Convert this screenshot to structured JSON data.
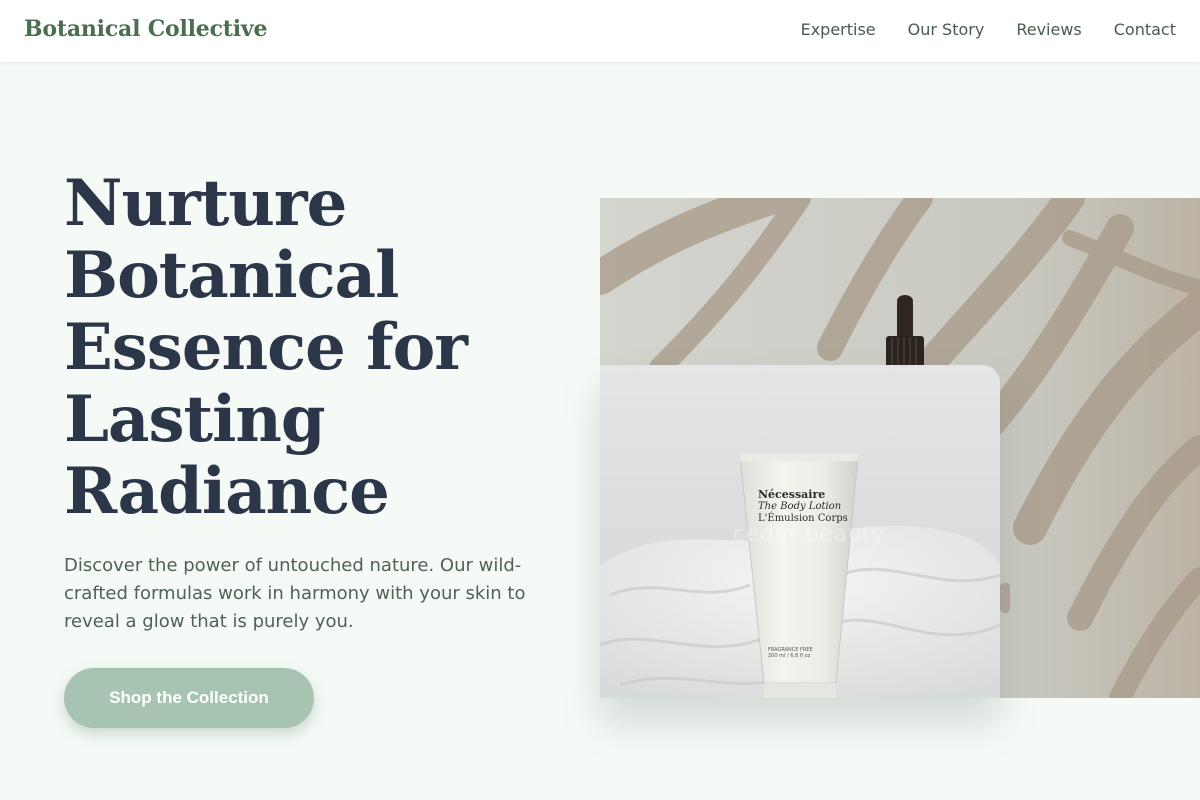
{
  "header": {
    "brand": "Botanical Collective",
    "nav": [
      "Expertise",
      "Our Story",
      "Reviews",
      "Contact"
    ]
  },
  "hero": {
    "title_lines": [
      "Nurture",
      "Botanical",
      "Essence for",
      "Lasting",
      "Radiance"
    ],
    "description": "Discover the power of untouched nature. Our wild-crafted formulas work in harmony with your skin to reveal a glow that is purely you.",
    "cta_label": "Shop the Collection"
  },
  "product": {
    "brand": "Nécessaire",
    "line1": "The Body Lotion",
    "line2": "L'Émulsion Corps",
    "small1": "FRAGRANCE FREE",
    "small2": "200 ml / 6.8 fl oz",
    "watermark": "cedar beauty"
  },
  "colors": {
    "brand": "#4b6e50",
    "title": "#2b3749",
    "cta_bg": "#a7c3b1",
    "page_bg": "#f5faf6"
  }
}
